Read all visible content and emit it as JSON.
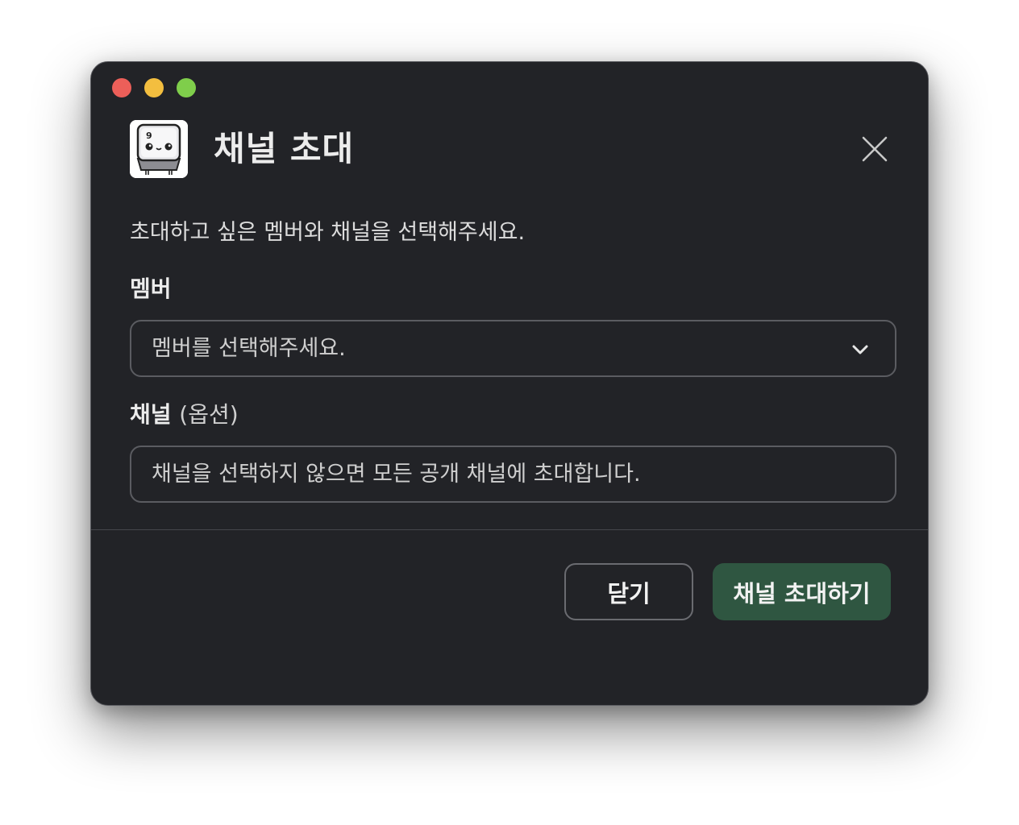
{
  "window": {
    "title": "채널 초대",
    "traffic_lights": [
      "close",
      "minimize",
      "zoom"
    ]
  },
  "app_icon": {
    "name": "keycap-mascot-icon",
    "glyph": "9"
  },
  "dialog": {
    "description": "초대하고 싶은 멤버와 채널을 선택해주세요.",
    "member": {
      "label": "멤버",
      "placeholder": "멤버를 선택해주세요."
    },
    "channel": {
      "label": "채널",
      "optional": "(옵션)",
      "placeholder": "채널을 선택하지 않으면 모든 공개 채널에 초대합니다."
    }
  },
  "footer": {
    "close_label": "닫기",
    "invite_label": "채널 초대하기"
  },
  "colors": {
    "background": "#222327",
    "primary_button": "#2f5641",
    "border": "#5b5c61"
  }
}
